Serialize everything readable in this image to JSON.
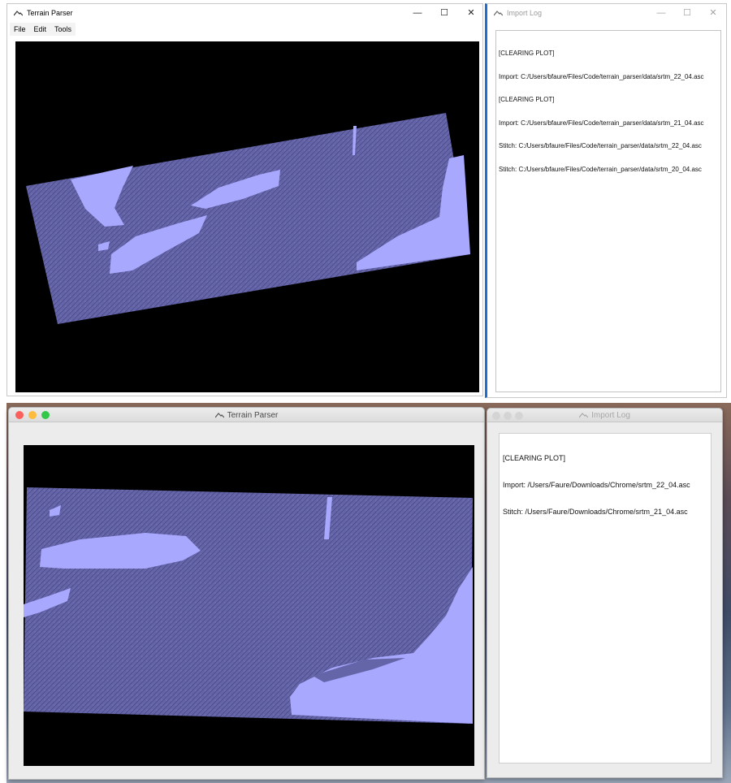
{
  "windows_section": {
    "main_window": {
      "title": "Terrain Parser",
      "controls": {
        "minimize": "—",
        "maximize": "☐",
        "close": "✕"
      },
      "menu": [
        "File",
        "Edit",
        "Tools"
      ]
    },
    "log_window": {
      "title": "Import Log",
      "controls": {
        "minimize": "—",
        "maximize": "☐",
        "close": "✕"
      },
      "lines": [
        "[CLEARING PLOT]",
        "Import: C:/Users/bfaure/Files/Code/terrain_parser/data/srtm_22_04.asc",
        "[CLEARING PLOT]",
        "Import: C:/Users/bfaure/Files/Code/terrain_parser/data/srtm_21_04.asc",
        "Stitch: C:/Users/bfaure/Files/Code/terrain_parser/data/srtm_22_04.asc",
        "Stitch: C:/Users/bfaure/Files/Code/terrain_parser/data/srtm_20_04.asc"
      ]
    }
  },
  "mac_section": {
    "main_window": {
      "title": "Terrain Parser"
    },
    "log_window": {
      "title": "Import Log",
      "lines": [
        "[CLEARING PLOT]",
        "Import: /Users/Faure/Downloads/Chrome/srtm_22_04.asc",
        "Stitch: /Users/Faure/Downloads/Chrome/srtm_21_04.asc"
      ]
    }
  },
  "colors": {
    "terrain": "#6464a8",
    "water": "#a8a8ff",
    "canvas": "#000000",
    "mac_close": "#fc605c",
    "mac_minimize": "#fdbc40",
    "mac_zoom": "#34c84a",
    "selection": "#1f6fd0"
  }
}
